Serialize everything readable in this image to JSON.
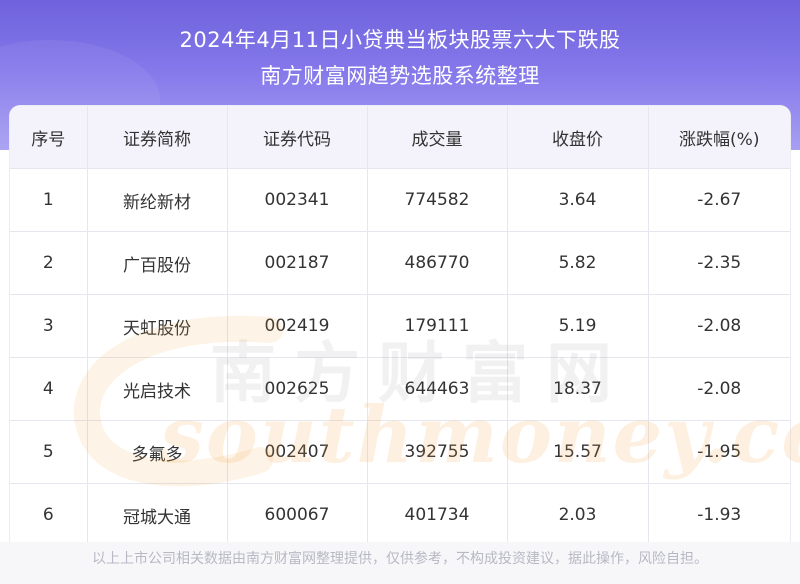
{
  "header": {
    "title_line1": "2024年4月11日小贷典当板块股票六大下跌股",
    "title_line2": "南方财富网趋势选股系统整理"
  },
  "table": {
    "columns": [
      "序号",
      "证券简称",
      "证券代码",
      "成交量",
      "收盘价",
      "涨跌幅(%)"
    ],
    "rows": [
      [
        "1",
        "新纶新材",
        "002341",
        "774582",
        "3.64",
        "-2.67"
      ],
      [
        "2",
        "广百股份",
        "002187",
        "486770",
        "5.82",
        "-2.35"
      ],
      [
        "3",
        "天虹股份",
        "002419",
        "179111",
        "5.19",
        "-2.08"
      ],
      [
        "4",
        "光启技术",
        "002625",
        "644463",
        "18.37",
        "-2.08"
      ],
      [
        "5",
        "多氟多",
        "002407",
        "392755",
        "15.57",
        "-1.95"
      ],
      [
        "6",
        "冠城大通",
        "600067",
        "401734",
        "2.03",
        "-1.93"
      ]
    ]
  },
  "watermark": {
    "cn": "南方财富网",
    "en": "southmoney.com"
  },
  "footer": {
    "disclaimer": "以上上市公司相关数据由南方财富网整理提供，仅供参考，不构成投资建议，据此操作，风险自担。"
  },
  "colors": {
    "header_top": "#6f62dc",
    "header_bottom": "#a79ff2",
    "table_header_bg": "#f4f3fb"
  }
}
